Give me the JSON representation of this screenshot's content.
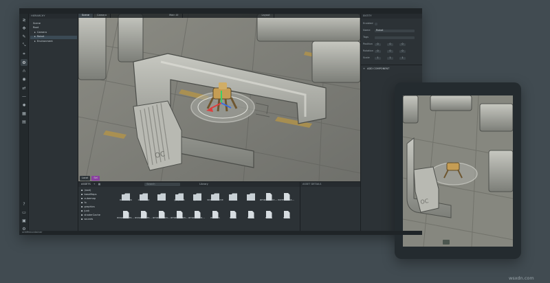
{
  "editor": {
    "status_text": "unitfilecontainer",
    "colors": {
      "accent": "#3b4a55",
      "asset_icon": "#d7dde1",
      "folder_icon": "#c9d1d6"
    }
  },
  "toolbar": {
    "tools": [
      {
        "icon": "logo-icon",
        "glyph": "≷",
        "active": false
      },
      {
        "icon": "move-tool-icon",
        "glyph": "✥",
        "active": false
      },
      {
        "icon": "pen-tool-icon",
        "glyph": "✎",
        "active": false
      },
      {
        "icon": "scale-tool-icon",
        "glyph": "⤡",
        "active": false
      },
      {
        "icon": "crop-tool-icon",
        "glyph": "⌗",
        "active": false
      },
      {
        "icon": "settings-tool-icon",
        "glyph": "⚙",
        "active": true
      },
      {
        "icon": "magnet-tool-icon",
        "glyph": "∩",
        "active": false
      },
      {
        "icon": "eye-tool-icon",
        "glyph": "◉",
        "active": false
      },
      {
        "icon": "refresh-tool-icon",
        "glyph": "⇄",
        "active": false
      },
      {
        "icon": "pin-tool-icon",
        "glyph": "—",
        "active": false
      },
      {
        "icon": "sun-tool-icon",
        "glyph": "✺",
        "active": false
      },
      {
        "icon": "grid-tool-icon",
        "glyph": "▦",
        "active": false
      },
      {
        "icon": "layers-tool-icon",
        "glyph": "▤",
        "active": false
      }
    ],
    "bottom_tools": [
      {
        "icon": "help-icon",
        "glyph": "?"
      },
      {
        "icon": "console-icon",
        "glyph": "▭"
      },
      {
        "icon": "monitor-icon",
        "glyph": "▣"
      },
      {
        "icon": "gear-icon",
        "glyph": "⚙"
      }
    ]
  },
  "hierarchy": {
    "title": "HIERARCHY",
    "items": [
      {
        "label": "Scene",
        "depth": 0,
        "selected": false
      },
      {
        "label": "Root",
        "depth": 0,
        "selected": false
      },
      {
        "label": "Camera",
        "depth": 1,
        "selected": false
      },
      {
        "label": "Robot",
        "depth": 1,
        "selected": true
      },
      {
        "label": "Environment",
        "depth": 1,
        "selected": false
      }
    ]
  },
  "viewport": {
    "tabs": [
      "Scene",
      "Camera",
      "Main UI",
      "Layout"
    ],
    "active_tab": 0,
    "bottom_chips": [
      "Local",
      "Sel"
    ]
  },
  "inspector": {
    "title": "ENTITY",
    "rows": [
      {
        "label": "Enabled",
        "kind": "check"
      },
      {
        "label": "Name",
        "kind": "text",
        "value": "Robot"
      },
      {
        "label": "Tags",
        "kind": "tags"
      },
      {
        "label": "Position",
        "kind": "vec3",
        "values": [
          "0",
          "0",
          "0"
        ]
      },
      {
        "label": "Rotation",
        "kind": "vec3",
        "values": [
          "0",
          "0",
          "0"
        ]
      },
      {
        "label": "Scale",
        "kind": "vec3",
        "values": [
          "1",
          "1",
          "1"
        ]
      }
    ],
    "add_component_label": "ADD COMPONENT"
  },
  "assets": {
    "title": "ASSETS",
    "search_placeholder": "Search",
    "tree": [
      "(root)",
      "baseMaps",
      "cubemap",
      "fx",
      "graphics",
      "junk",
      "shaderCache",
      "sounds"
    ],
    "row1": [
      "baseMaps",
      "cubemap",
      "fx",
      "graphics",
      "junk",
      "shaderCache",
      "sounds",
      "ui",
      "ambientOccl...",
      "normalsAsse..."
    ],
    "row2": [
      "dissolveMeta...",
      "dissolveMeta...",
      "ambientCont...",
      "ambientCont...",
      "ambientTransp...",
      "emmPS",
      "flatPS",
      "flatPS",
      "flatPS",
      "flatPS"
    ],
    "details_title": "ASSET DETAILS",
    "library_label": "Library"
  },
  "watermark": "wsxdn.com"
}
